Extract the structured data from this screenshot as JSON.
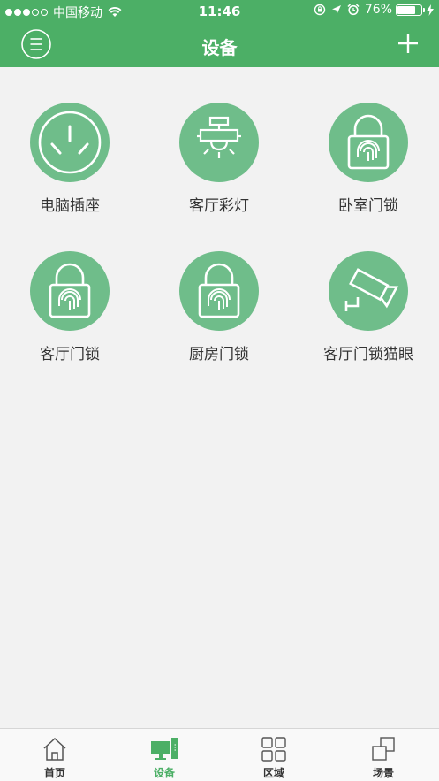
{
  "status_bar": {
    "carrier": "中国移动",
    "time": "11:46",
    "battery_percent": "76%"
  },
  "nav": {
    "title": "设备"
  },
  "devices": [
    {
      "label": "电脑插座",
      "icon": "power-socket-icon"
    },
    {
      "label": "客厅彩灯",
      "icon": "ceiling-lamp-icon"
    },
    {
      "label": "卧室门锁",
      "icon": "fingerprint-lock-icon"
    },
    {
      "label": "客厅门锁",
      "icon": "fingerprint-lock-icon"
    },
    {
      "label": "厨房门锁",
      "icon": "fingerprint-lock-icon"
    },
    {
      "label": "客厅门锁猫眼",
      "icon": "security-camera-icon"
    }
  ],
  "tabs": [
    {
      "label": "首页",
      "icon": "home-icon"
    },
    {
      "label": "设备",
      "icon": "devices-icon"
    },
    {
      "label": "区域",
      "icon": "grid-icon"
    },
    {
      "label": "场景",
      "icon": "scene-icon"
    }
  ],
  "active_tab": "设备",
  "colors": {
    "header": "#4caf66",
    "device_circle": "#6fbd8a",
    "background": "#f2f2f2",
    "active_tab": "#4caf66"
  }
}
